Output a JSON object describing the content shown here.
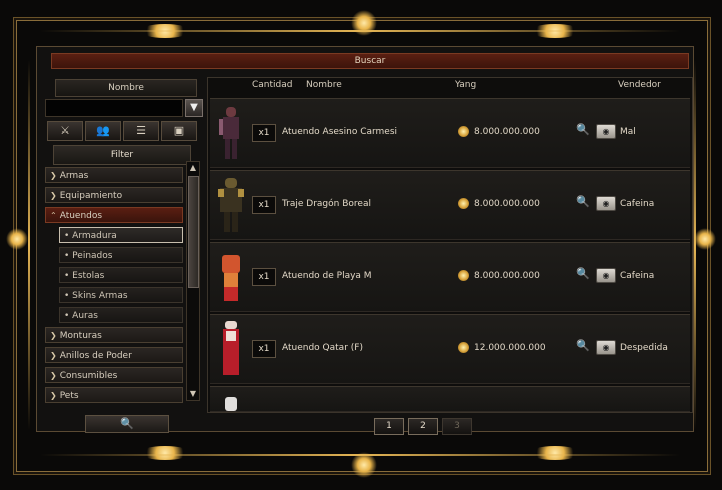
{
  "window": {
    "title": "Buscar"
  },
  "left": {
    "nombre_label": "Nombre",
    "search_value": "",
    "tabs": [
      "warriors-icon",
      "group-icon",
      "list-icon",
      "save-icon"
    ],
    "filter_label": "Filter",
    "categories": [
      {
        "label": "Armas",
        "expanded": false
      },
      {
        "label": "Equipamiento",
        "expanded": false
      },
      {
        "label": "Atuendos",
        "expanded": true
      },
      {
        "label": "Monturas",
        "expanded": false
      },
      {
        "label": "Anillos de Poder",
        "expanded": false
      },
      {
        "label": "Consumibles",
        "expanded": false
      },
      {
        "label": "Pets",
        "expanded": false
      }
    ],
    "subcategories": [
      "• Armadura",
      "• Peinados",
      "• Estolas",
      "• Skins Armas",
      "• Auras"
    ],
    "selected_subcategory": "• Armadura"
  },
  "table": {
    "headers": {
      "cantidad": "Cantidad",
      "nombre": "Nombre",
      "yang": "Yang",
      "vendedor": "Vendedor"
    },
    "rows": [
      {
        "qty": "x1",
        "name": "Atuendo Asesino Carmesi",
        "price": "8.000.000.000",
        "seller": "Mal"
      },
      {
        "qty": "x1",
        "name": "Traje Dragón Boreal",
        "price": "8.000.000.000",
        "seller": "Cafeina"
      },
      {
        "qty": "x1",
        "name": "Atuendo de Playa M",
        "price": "8.000.000.000",
        "seller": "Cafeina"
      },
      {
        "qty": "x1",
        "name": "Atuendo Qatar (F)",
        "price": "12.000.000.000",
        "seller": "Despedida"
      }
    ]
  },
  "pagination": {
    "pages": [
      "1",
      "2",
      "3"
    ],
    "disabled": [
      "3"
    ]
  },
  "colors": {
    "accent_gold": "#e6b655",
    "active_category": "#5a1e12",
    "title_bar": "#5a1f12"
  }
}
